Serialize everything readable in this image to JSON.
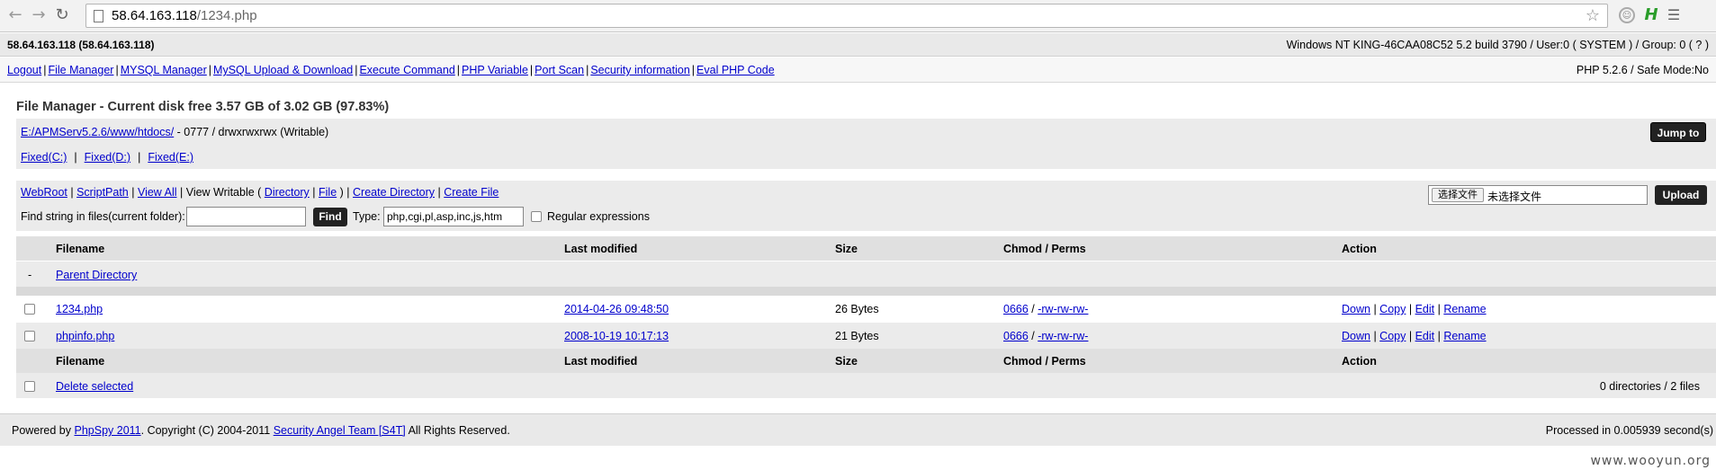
{
  "browser": {
    "url_host": "58.64.163.118",
    "url_path": "/1234.php"
  },
  "header": {
    "host": "58.64.163.118 (58.64.163.118)",
    "sysinfo": "Windows NT KING-46CAA08C52 5.2 build 3790 / User:0 ( SYSTEM ) / Group: 0 ( ? )"
  },
  "menu": {
    "items": [
      "Logout",
      "File Manager",
      "MYSQL Manager",
      "MySQL Upload & Download",
      "Execute Command",
      "PHP Variable",
      "Port Scan",
      "Security information",
      "Eval PHP Code"
    ],
    "php_info": "PHP 5.2.6 / Safe Mode:No"
  },
  "file_manager": {
    "title": "File Manager - Current disk free 3.57 GB of 3.02 GB (97.83%)",
    "current_path": "E:/APMServ5.2.6/www/htdocs/",
    "path_perms": " - 0777 / drwxrwxrwx (Writable)",
    "jump_label": "Jump to",
    "drives": [
      "Fixed(C:)",
      "Fixed(D:)",
      "Fixed(E:)"
    ],
    "drive_sep": "|"
  },
  "tools": {
    "webroot": "WebRoot",
    "scriptpath": "ScriptPath",
    "view_all": "View All",
    "view_writable": "View Writable (",
    "directory": "Directory",
    "file": "File",
    "close_paren": ")",
    "create_dir": "Create Directory",
    "create_file": "Create File",
    "find_label": "Find string in files(current folder):",
    "find_value": "",
    "find_btn": "Find",
    "type_label": "Type:",
    "type_value": "php,cgi,pl,asp,inc,js,htm",
    "regex_label": "Regular expressions",
    "choose_file": "选择文件",
    "no_file": "未选择文件",
    "upload_btn": "Upload"
  },
  "table": {
    "columns": [
      "Filename",
      "Last modified",
      "Size",
      "Chmod / Perms",
      "Action"
    ],
    "parent_dash": "-",
    "parent_label": "Parent Directory",
    "rows": [
      {
        "name": "1234.php",
        "modified": "2014-04-26 09:48:50",
        "size": "26 Bytes",
        "chmod": "0666",
        "perms": "-rw-rw-rw-"
      },
      {
        "name": "phpinfo.php",
        "modified": "2008-10-19 10:17:13",
        "size": "21 Bytes",
        "chmod": "0666",
        "perms": "-rw-rw-rw-"
      }
    ],
    "actions": [
      "Down",
      "Copy",
      "Edit",
      "Rename"
    ],
    "delete_selected": "Delete selected",
    "summary": "0 directories / 2 files"
  },
  "footer": {
    "powered_prefix": "Powered by ",
    "phpspy": "PhpSpy 2011",
    "copyright": ". Copyright (C) 2004-2011 ",
    "team": "Security Angel Team [S4T]",
    "rights": " All Rights Reserved.",
    "processed": "Processed in 0.005939 second(s)"
  },
  "watermark": "www.wooyun.org"
}
